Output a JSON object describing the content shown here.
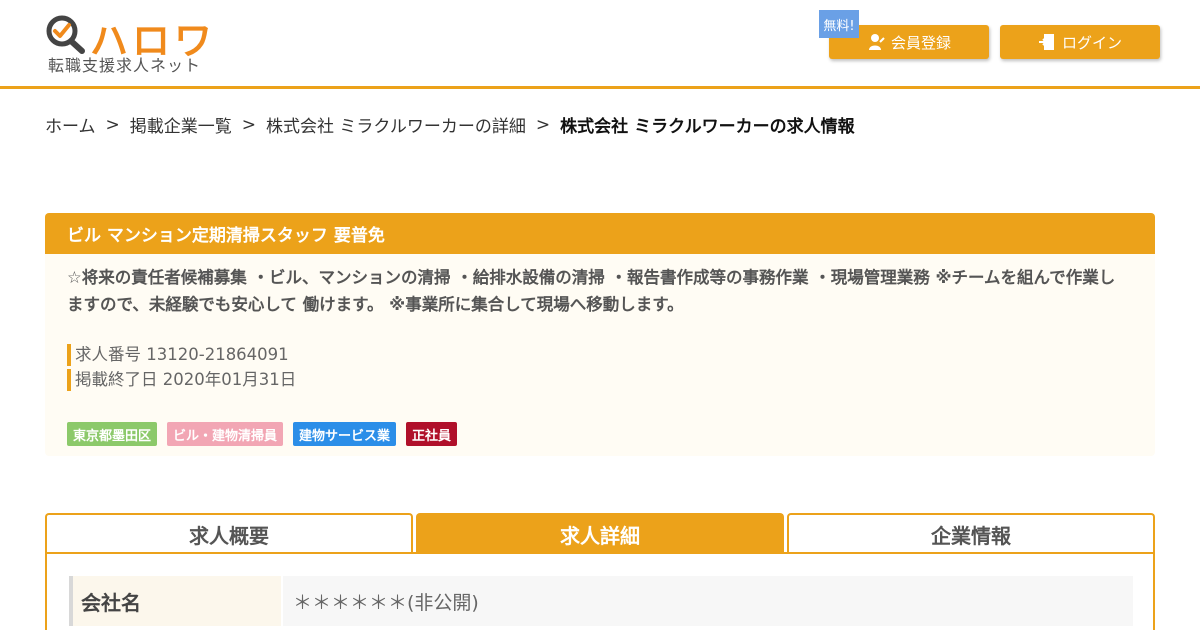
{
  "header": {
    "logo_text": "ハロワ",
    "logo_sub": "転職支援求人ネット",
    "free_badge": "無料!",
    "register_label": "会員登録",
    "login_label": "ログイン",
    "accent_color": "#eca21a"
  },
  "breadcrumb": {
    "items": [
      "ホーム",
      "掲載企業一覧",
      "株式会社 ミラクルワーカーの詳細"
    ],
    "current": "株式会社 ミラクルワーカーの求人情報",
    "separator": ">"
  },
  "job": {
    "title": "ビル マンション定期清掃スタッフ 要普免",
    "description": "☆将来の責任者候補募集 ・ビル、マンションの清掃 ・給排水設備の清掃 ・報告書作成等の事務作業 ・現場管理業務 ※チームを組んで作業しますので、未経験でも安心して 働けます。 ※事業所に集合して現場へ移動します。",
    "number_label": "求人番号",
    "number": "13120-21864091",
    "end_label": "掲載終了日",
    "end_date": "2020年01月31日",
    "tags": [
      {
        "label": "東京都墨田区",
        "color": "#8cc96a"
      },
      {
        "label": "ビル・建物清掃員",
        "color": "#f2a6b4"
      },
      {
        "label": "建物サービス業",
        "color": "#2b8ee8"
      },
      {
        "label": "正社員",
        "color": "#b0102a"
      }
    ]
  },
  "tabs": [
    {
      "label": "求人概要",
      "active": false
    },
    {
      "label": "求人詳細",
      "active": true
    },
    {
      "label": "企業情報",
      "active": false
    }
  ],
  "details": {
    "company_label": "会社名",
    "company_value": "＊＊＊＊＊＊(非公開)"
  }
}
